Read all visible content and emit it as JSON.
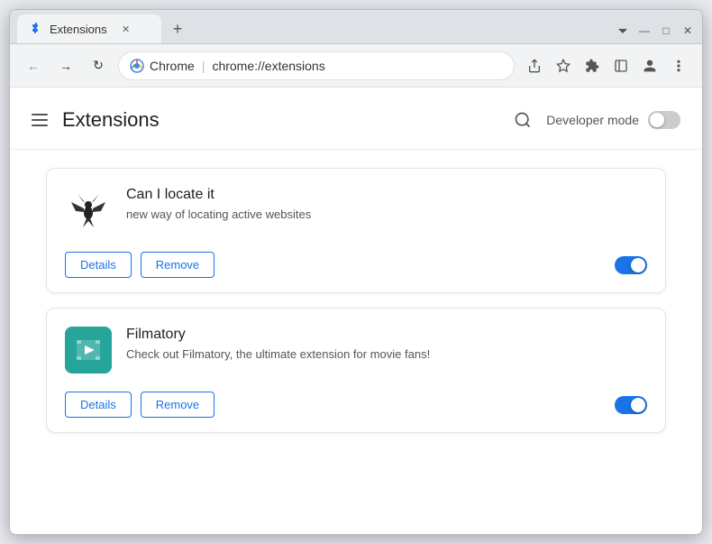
{
  "window": {
    "title": "Extensions",
    "controls": {
      "minimize": "—",
      "maximize": "□",
      "close": "✕"
    }
  },
  "tab": {
    "label": "Extensions",
    "close_label": "✕",
    "new_tab_label": "+"
  },
  "toolbar": {
    "back_label": "←",
    "forward_label": "→",
    "reload_label": "↻",
    "chrome_label": "Chrome",
    "url": "chrome://extensions",
    "separator": "|",
    "share_icon": "share-icon",
    "bookmark_icon": "star-icon",
    "extensions_icon": "puzzle-icon",
    "sidebar_icon": "sidebar-icon",
    "profile_icon": "person-icon",
    "menu_icon": "menu-dots-icon"
  },
  "page": {
    "title": "Extensions",
    "developer_mode_label": "Developer mode",
    "developer_mode_state": "off"
  },
  "extensions": [
    {
      "id": "ext-1",
      "name": "Can I locate it",
      "description": "new way of locating active websites",
      "details_label": "Details",
      "remove_label": "Remove",
      "enabled": true,
      "icon_type": "bird"
    },
    {
      "id": "ext-2",
      "name": "Filmatory",
      "description": "Check out Filmatory, the ultimate extension for movie fans!",
      "details_label": "Details",
      "remove_label": "Remove",
      "enabled": true,
      "icon_type": "film"
    }
  ]
}
